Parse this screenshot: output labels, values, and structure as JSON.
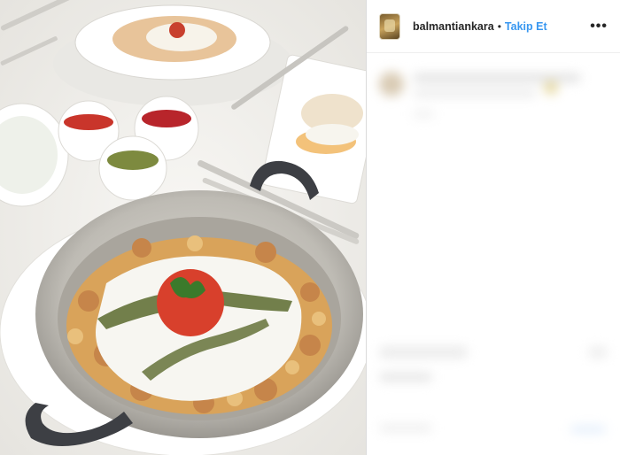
{
  "post": {
    "username": "balmantiankara",
    "separator": "•",
    "follow_label": "Takip Et",
    "more_icon": "more-options-icon"
  },
  "photo": {
    "subject": "",
    "colors": {
      "background": "#f2f1ee",
      "pan": "#bdbab3",
      "yogurt": "#f7f6f1",
      "sauce": "#d8402c",
      "pasta": "#d9a35a",
      "herb": "#5b6a2e"
    }
  }
}
